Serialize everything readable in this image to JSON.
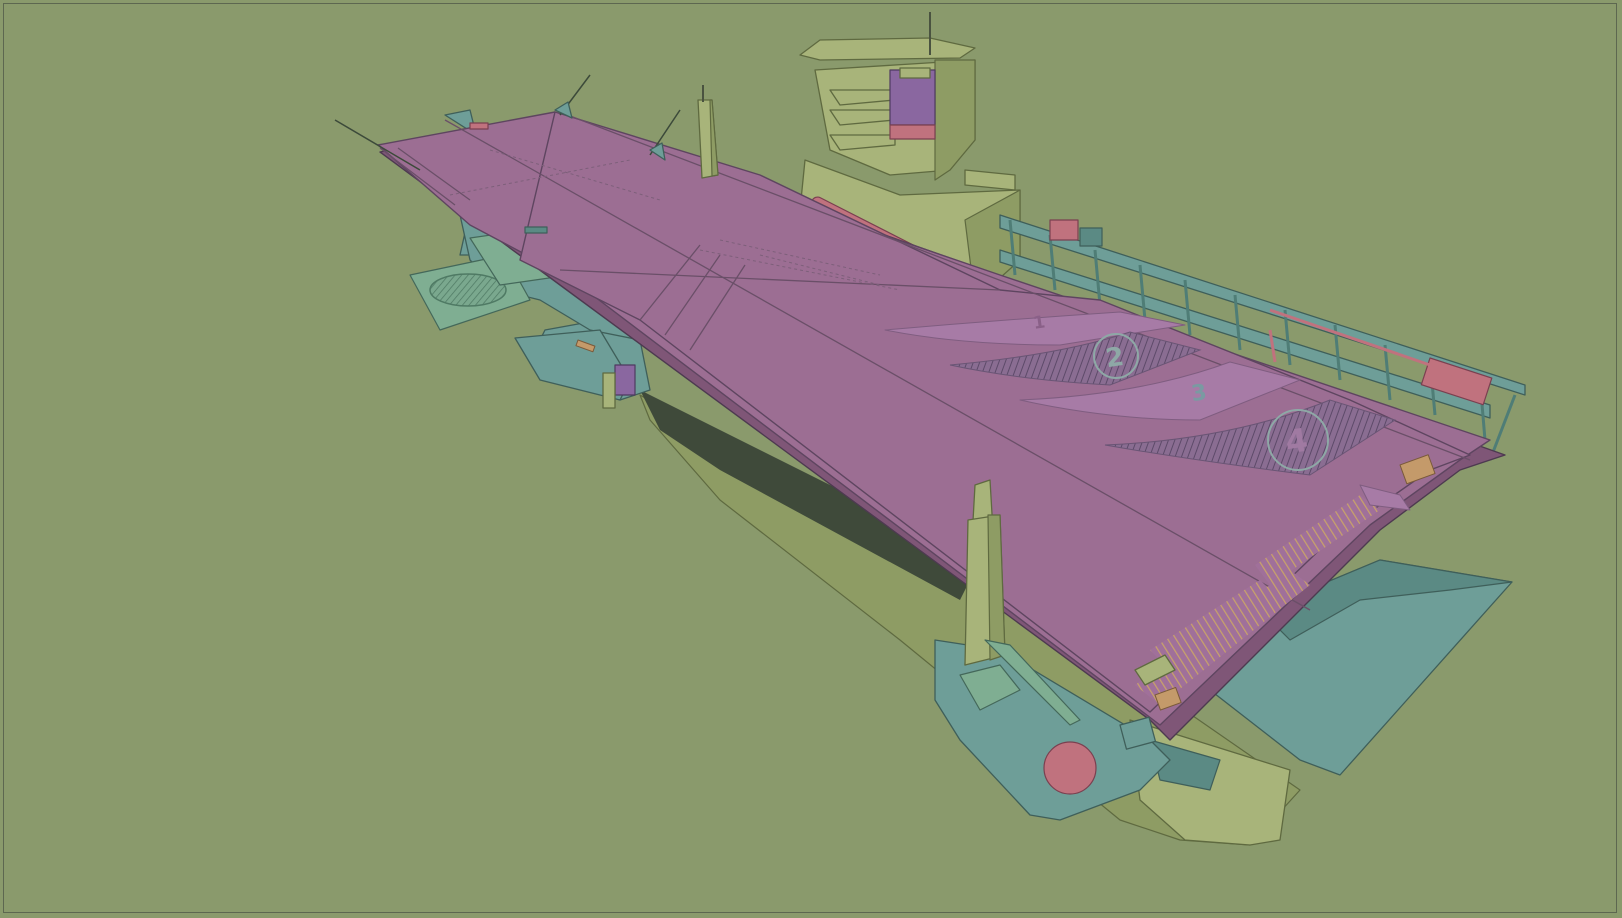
{
  "scene": {
    "colors": {
      "background": "#8a9a6c",
      "flight_deck": "#9c6e93",
      "flight_deck_edge": "#7f5677",
      "hull": "#6e9e98",
      "hull_dark": "#5b8a84",
      "island": "#a8b47a",
      "island_shadow": "#8e9c64",
      "accent_red": "#c0727e",
      "accent_purple": "#8a67a0",
      "hatch": "#6c5a78",
      "shadow_side": "#3f4a3a"
    },
    "landing_spots": [
      {
        "label": "1"
      },
      {
        "label": "2"
      },
      {
        "label": "3"
      },
      {
        "label": "4"
      }
    ]
  }
}
